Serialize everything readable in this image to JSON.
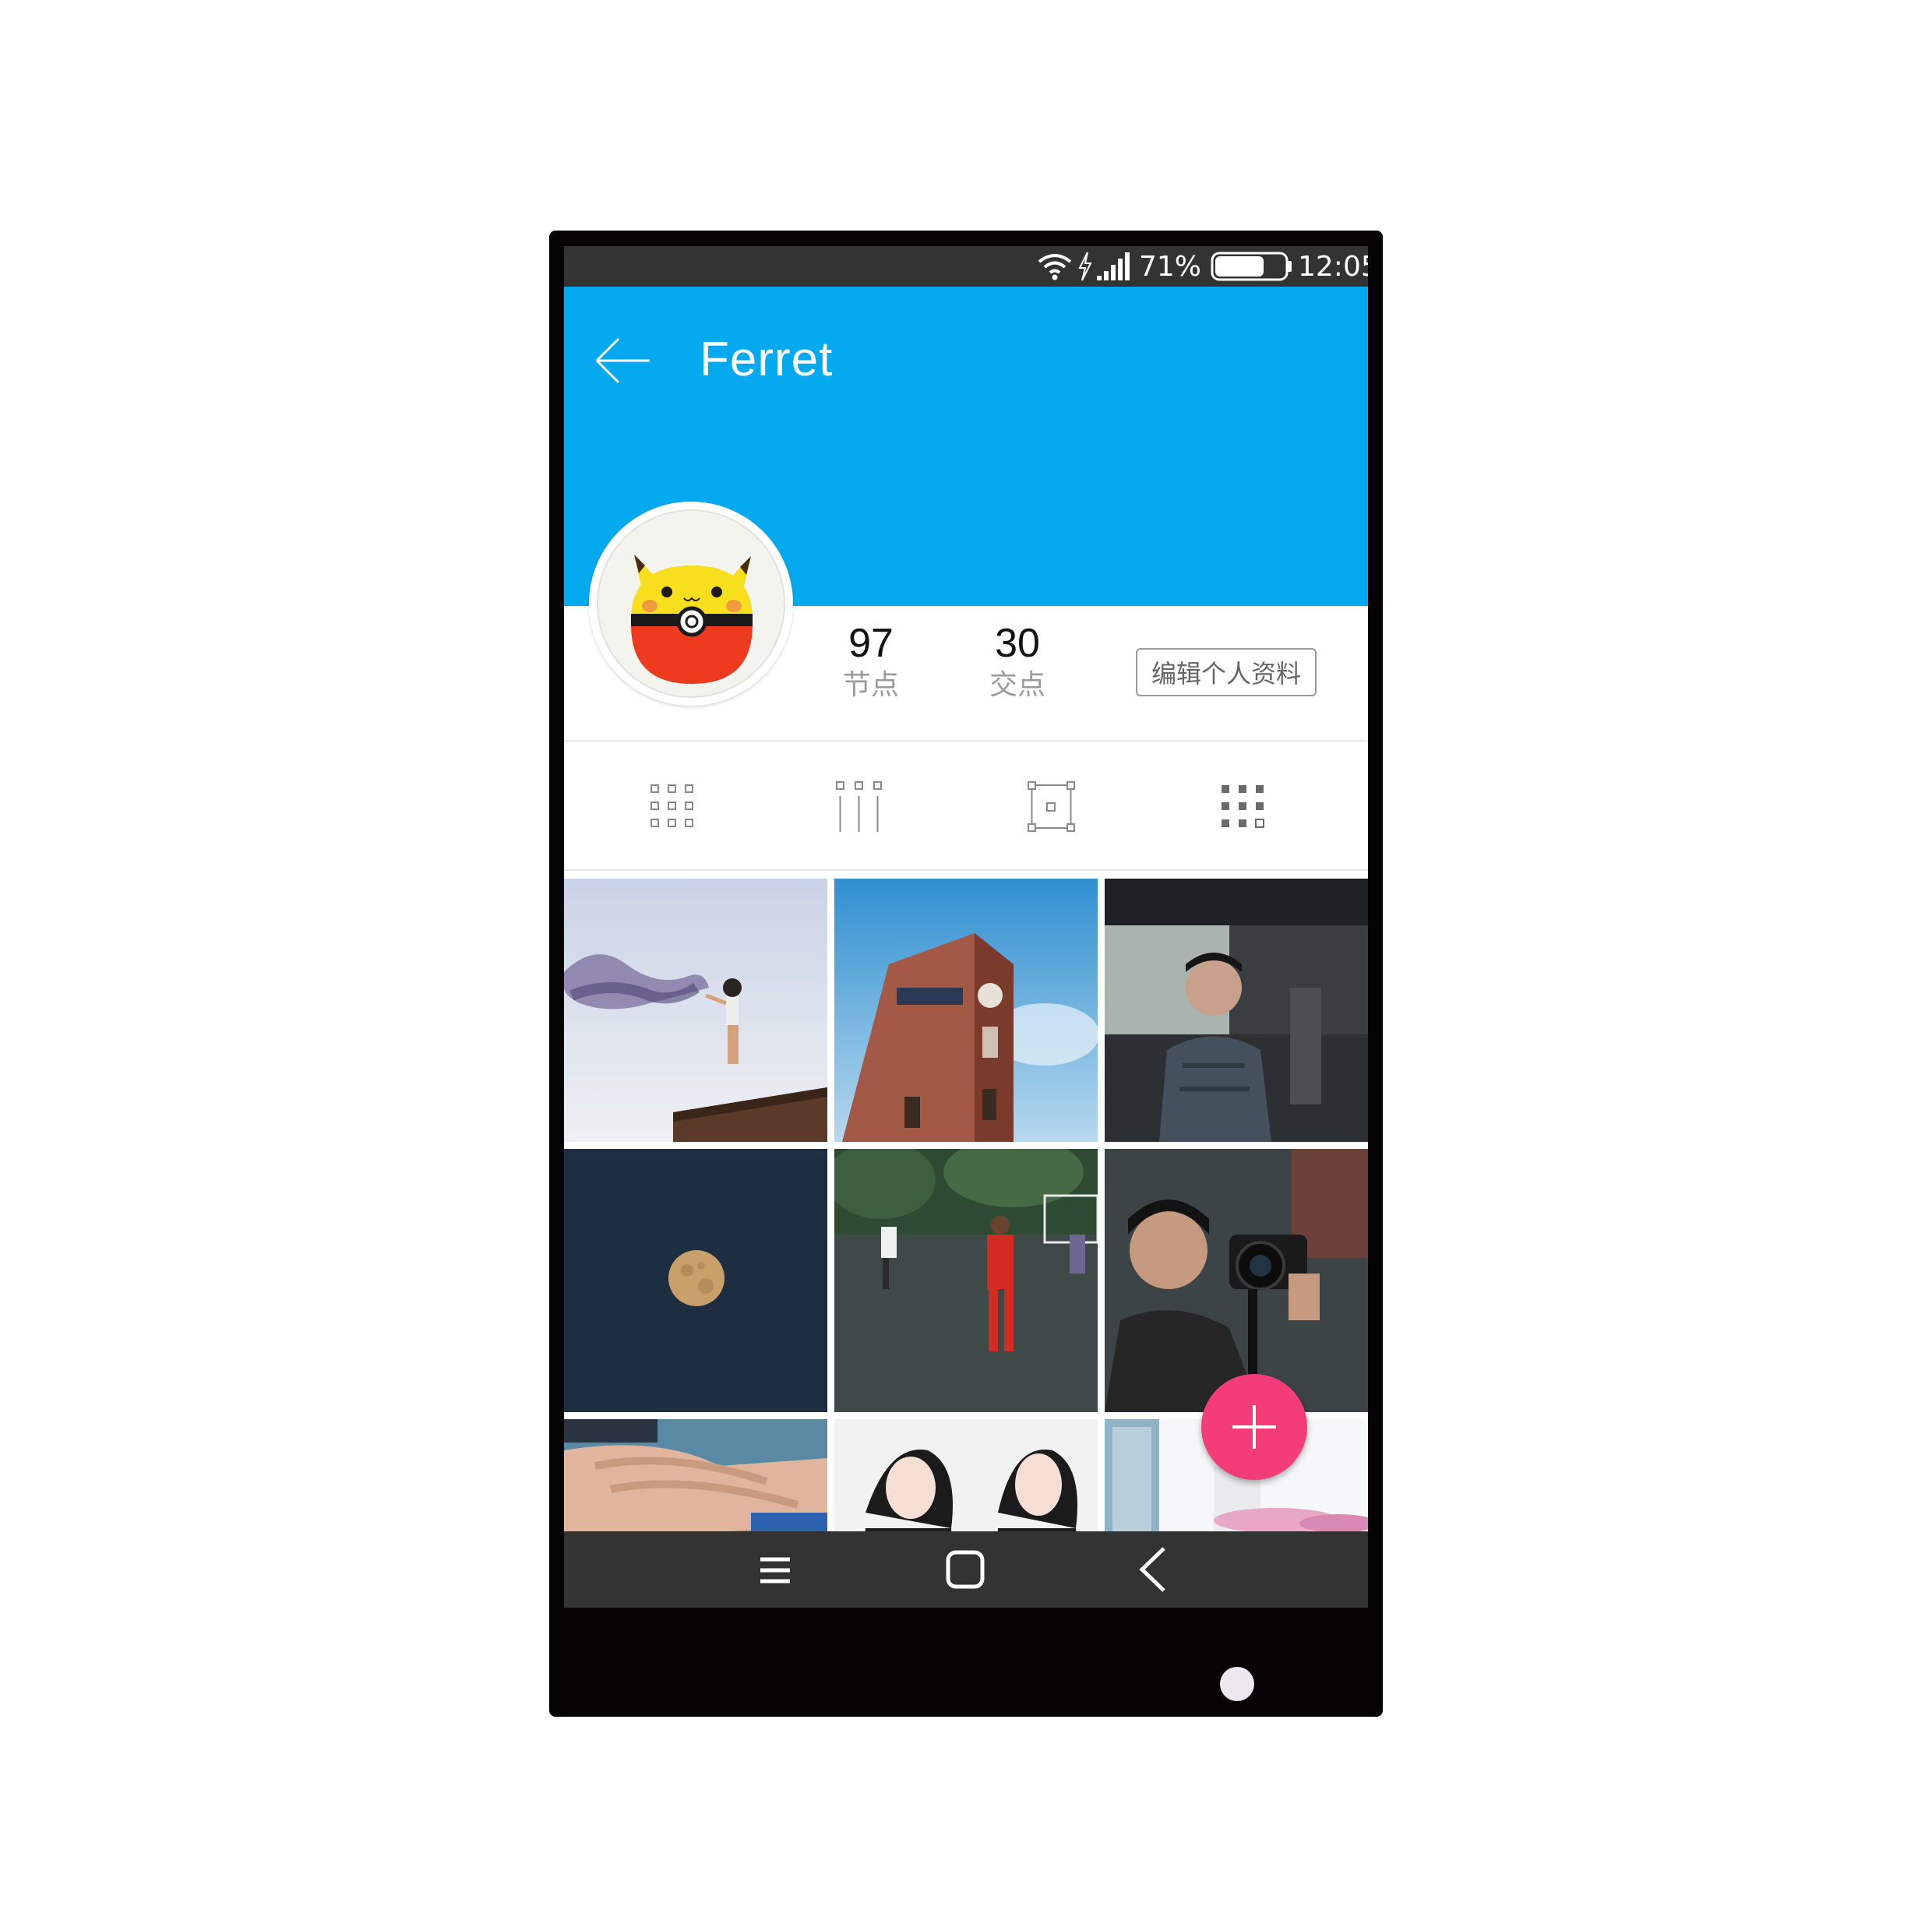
{
  "status_bar": {
    "battery_percent": "71%",
    "battery_level": 0.71,
    "time": "12:05",
    "icons": [
      "wifi-icon",
      "charging-icon",
      "signal-icon",
      "battery-icon"
    ]
  },
  "app_bar": {
    "back_icon": "back-arrow-icon",
    "title": "Ferret",
    "color": "#05a9f0"
  },
  "profile": {
    "avatar_icon": "pikachu-pokeball-avatar",
    "stats": [
      {
        "value": "97",
        "label": "节点"
      },
      {
        "value": "30",
        "label": "交点"
      }
    ],
    "edit_button_label": "编辑个人资料"
  },
  "view_tabs": [
    {
      "icon": "grid-view-icon"
    },
    {
      "icon": "column-view-icon"
    },
    {
      "icon": "crop-frame-icon"
    },
    {
      "icon": "dense-grid-icon"
    }
  ],
  "photos": [
    {
      "name": "photo-smoke-bomb-rooftop"
    },
    {
      "name": "photo-university-tower"
    },
    {
      "name": "photo-man-in-tunnel"
    },
    {
      "name": "photo-full-moon"
    },
    {
      "name": "photo-football-players"
    },
    {
      "name": "photo-man-with-camera"
    },
    {
      "name": "photo-stacked-hands"
    },
    {
      "name": "photo-two-girls"
    },
    {
      "name": "photo-buildings-flowers"
    }
  ],
  "fab": {
    "icon": "plus-icon",
    "color": "#f43d78"
  },
  "nav_bar": [
    {
      "icon": "menu-icon"
    },
    {
      "icon": "home-square-icon"
    },
    {
      "icon": "back-chevron-icon"
    }
  ]
}
